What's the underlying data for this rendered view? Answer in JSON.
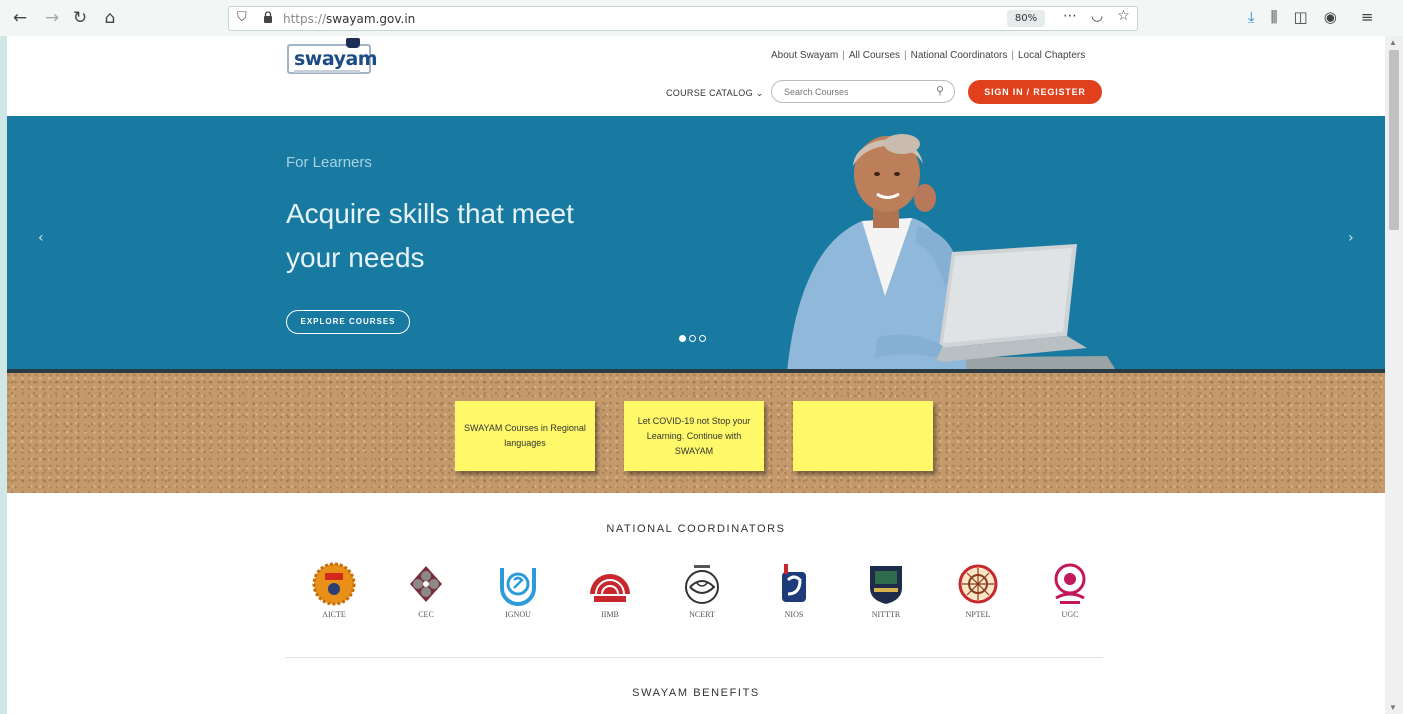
{
  "browser": {
    "url_proto": "https://",
    "url_host": "swayam.gov.in",
    "zoom": "80%"
  },
  "header": {
    "logo_text": "swayam",
    "top_links": [
      "About Swayam",
      "All Courses",
      "National Coordinators",
      "Local Chapters"
    ],
    "catalog_label": "COURSE CATALOG",
    "search_placeholder": "Search Courses",
    "signin_label": "SIGN IN / REGISTER"
  },
  "hero": {
    "eyebrow": "For Learners",
    "title": "Acquire skills that meet your needs",
    "button_label": "EXPLORE COURSES",
    "slides_total": 3,
    "active_slide": 1
  },
  "notes": [
    {
      "text": "SWAYAM Courses in Regional languages"
    },
    {
      "text": "Let COVID-19 not Stop your Learning. Continue with SWAYAM"
    },
    {
      "text": ""
    }
  ],
  "coordinators": {
    "title": "NATIONAL COORDINATORS",
    "items": [
      {
        "label": "AICTE",
        "icon": "aicte-logo"
      },
      {
        "label": "CEC",
        "icon": "cec-logo"
      },
      {
        "label": "IGNOU",
        "icon": "ignou-logo"
      },
      {
        "label": "IIMB",
        "icon": "iimb-logo"
      },
      {
        "label": "NCERT",
        "icon": "ncert-logo"
      },
      {
        "label": "NIOS",
        "icon": "nios-logo"
      },
      {
        "label": "NITTTR",
        "icon": "nitttr-logo"
      },
      {
        "label": "NPTEL",
        "icon": "nptel-logo"
      },
      {
        "label": "UGC",
        "icon": "ugc-logo"
      }
    ]
  },
  "benefits": {
    "title": "SWAYAM BENEFITS"
  },
  "colors": {
    "hero_bg": "#187aa0",
    "signin_bg": "#e1401c",
    "note_bg": "#fff96a",
    "cork_bg": "#c49a6c"
  }
}
